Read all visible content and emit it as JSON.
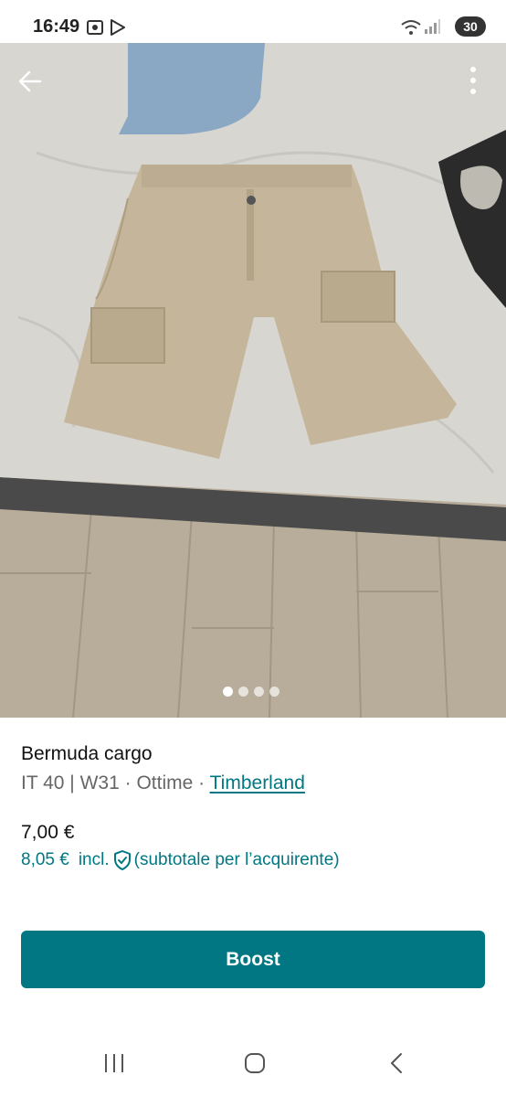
{
  "status_bar": {
    "time": "16:49",
    "battery": "30",
    "icons": [
      "screenshot-icon",
      "play-store-icon",
      "wifi-icon",
      "signal-icon"
    ]
  },
  "listing": {
    "photo": {
      "description_colors": {
        "sheet": "#d6d4cf",
        "shorts": "#c4b59a",
        "floor": "#b9ad9c"
      },
      "dot_count": 4,
      "active_dot": 0
    },
    "title": "Bermuda cargo",
    "size": "IT 40 | W31",
    "separator": "·",
    "condition": "Ottime",
    "brand": "Timberland",
    "price": "7,00 €",
    "price_total": "8,05 €",
    "incl_label": "incl.",
    "buyer_note": "(subtotale per l’acquirente)"
  },
  "actions": {
    "boost_label": "Boost"
  },
  "colors": {
    "accent": "#007782"
  }
}
